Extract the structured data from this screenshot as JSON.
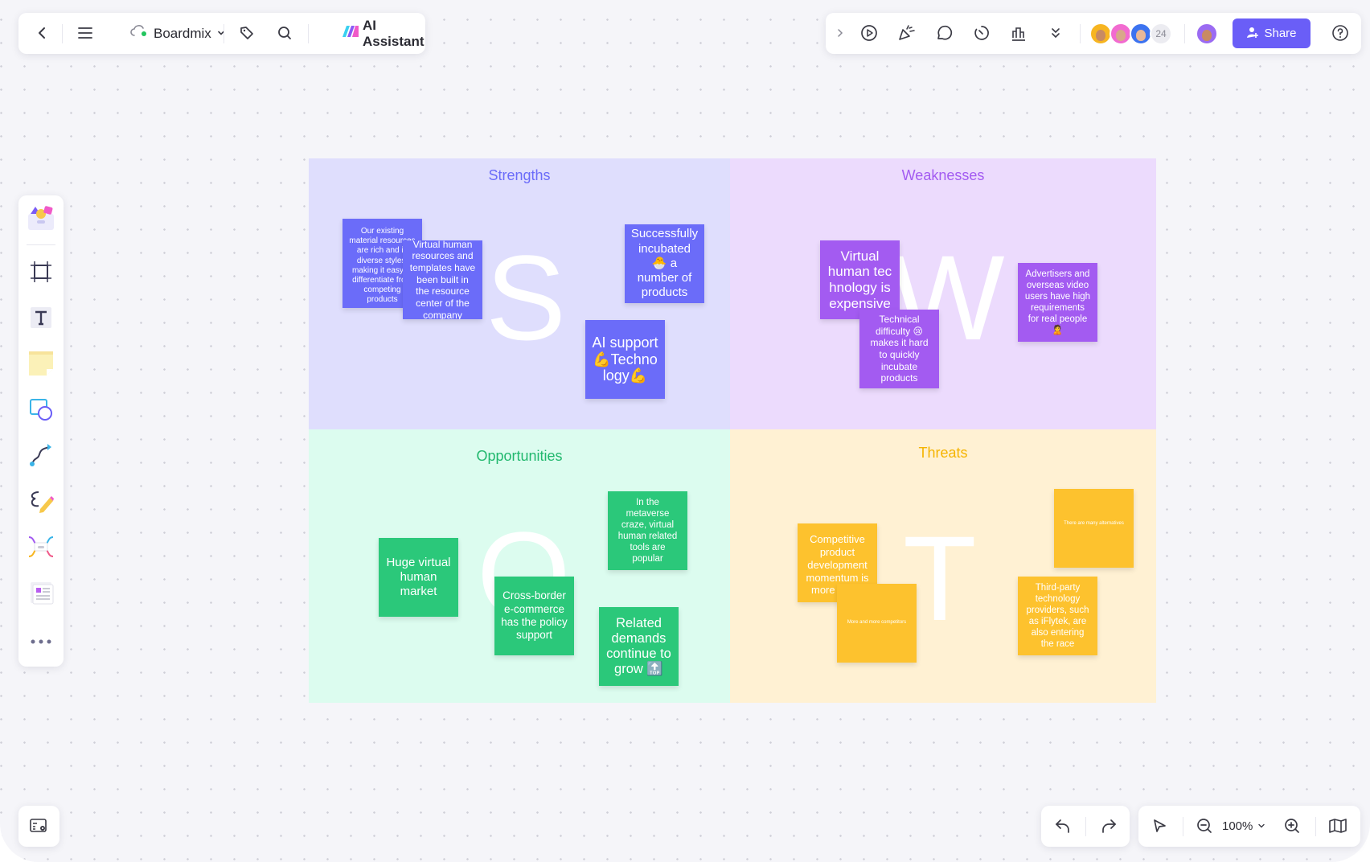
{
  "app": {
    "name": "Boardmix",
    "ai_label": "AI Assistant",
    "share_label": "Share",
    "collaborator_count": "24"
  },
  "toolbar_left": {
    "icons": [
      "back-icon",
      "menu-icon",
      "cloud-sync-icon",
      "chevron-down-icon",
      "tag-icon",
      "search-icon",
      "ai-logo-icon"
    ]
  },
  "toolbar_right": {
    "icons": [
      "expand-icon",
      "present-icon",
      "celebrate-icon",
      "comment-icon",
      "timer-icon",
      "vote-icon",
      "more-icon",
      "help-icon"
    ],
    "collaborators": [
      {
        "name": "collaborator-1",
        "color": "#f7b521"
      },
      {
        "name": "collaborator-2",
        "color": "#f26bd0"
      },
      {
        "name": "collaborator-3",
        "color": "#3c73f0"
      }
    ],
    "me": {
      "color": "#9b6bf2"
    }
  },
  "left_tools": [
    {
      "name": "templates"
    },
    {
      "name": "frame"
    },
    {
      "name": "text"
    },
    {
      "name": "sticky-note"
    },
    {
      "name": "shapes"
    },
    {
      "name": "connector"
    },
    {
      "name": "pen"
    },
    {
      "name": "mind-map"
    },
    {
      "name": "cards"
    },
    {
      "name": "more"
    }
  ],
  "zoom": {
    "level": "100%"
  },
  "swot": {
    "strengths": {
      "title": "Strengths",
      "letter": "S",
      "title_color": "#6b6cf9",
      "bg": "#dfdefd",
      "notes": [
        "Our existing material resources are rich and in diverse styles, making it easy to differentiate from competing products",
        "Virtual human resources and templates have been built in the resource center of the company",
        "Successfully incubated 🐣 a number of products",
        "AI support 💪Techno logy💪"
      ]
    },
    "weaknesses": {
      "title": "Weaknesses",
      "letter": "W",
      "title_color": "#a35bf1",
      "bg": "#ecdbfd",
      "notes": [
        "Virtual human tec hnology is expensive",
        "Technical difficulty 😢 makes it hard to quickly incubate products",
        "Advertisers and overseas video users have high requirements for real people 🙎"
      ]
    },
    "opportunities": {
      "title": "Opportunities",
      "letter": "O",
      "title_color": "#22b86e",
      "bg": "#dcfcef",
      "notes": [
        "Huge virtual human market",
        "Cross-border e-commerce has the policy support",
        "In the metaverse craze, virtual human related tools are popular",
        "Related demands continue to grow 🔝"
      ]
    },
    "threats": {
      "title": "Threats",
      "letter": "T",
      "title_color": "#f5b400",
      "bg": "#fff1d3",
      "notes": [
        "Competitive product development momentum is more fierce",
        "More and more competitors",
        "There are many alternatives",
        "Third-party technology providers, such as iFlytek, are also entering the race"
      ]
    }
  }
}
